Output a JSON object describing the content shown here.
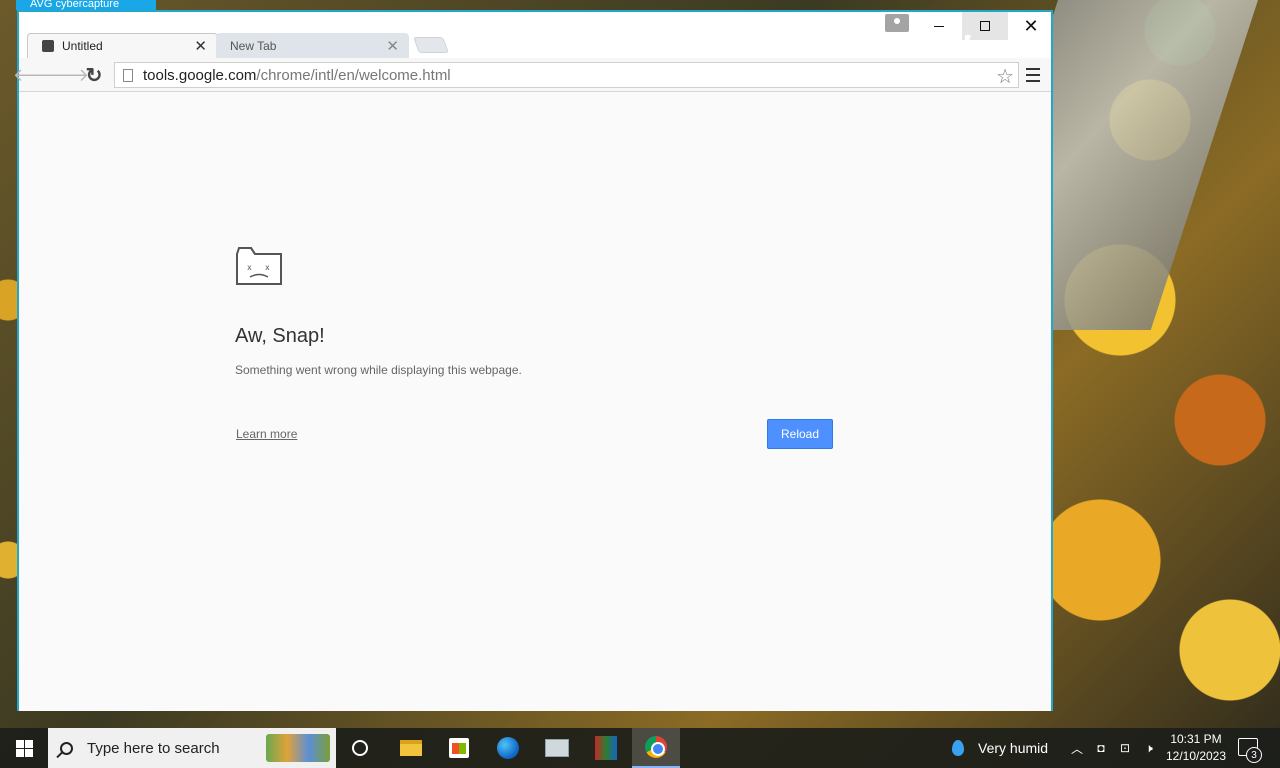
{
  "avg_badge": "AVG cybercapture",
  "browser": {
    "tabs": [
      {
        "label": "Untitled",
        "active": true
      },
      {
        "label": "New Tab",
        "active": false
      }
    ],
    "address": {
      "host": "tools.google.com",
      "path": "/chrome/intl/en/welcome.html"
    },
    "icons": {
      "back": "back-arrow-icon",
      "forward": "forward-arrow-icon",
      "reload": "reload-icon",
      "star": "bookmark-star-icon",
      "menu": "hamburger-menu-icon"
    }
  },
  "error_page": {
    "title": "Aw, Snap!",
    "message": "Something went wrong while displaying this webpage.",
    "learn_more": "Learn more",
    "reload_button": "Reload"
  },
  "taskbar": {
    "search_placeholder": "Type here to search",
    "weather": "Very humid",
    "time": "10:31 PM",
    "date": "12/10/2023",
    "notification_count": "3"
  },
  "colors": {
    "window_border": "#22a6c9",
    "reload_button": "#4d90fe",
    "avg_badge": "#1aa7e8"
  }
}
